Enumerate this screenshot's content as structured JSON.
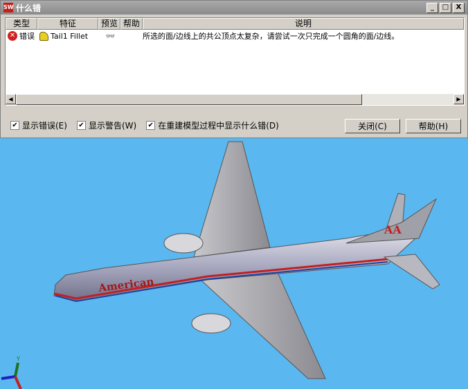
{
  "window": {
    "title": "什么错",
    "logo": "SW",
    "minimize": "_",
    "maximize": "□",
    "close": "X"
  },
  "columns": [
    "类型",
    "特征",
    "预览",
    "帮助",
    "说明"
  ],
  "rows": [
    {
      "type": "错误",
      "feature": "Tail1 Fillet",
      "description": "所选的面/边线上的共公顶点太复杂，请尝试一次只完成一个圆角的面/边线。"
    }
  ],
  "options": [
    {
      "label": "显示错误(E)",
      "checked": true
    },
    {
      "label": "显示警告(W)",
      "checked": true
    },
    {
      "label": "在重建模型过程中显示什么错(D)",
      "checked": true
    }
  ],
  "buttons": {
    "close": "关闭(C)",
    "help": "帮助(H)"
  },
  "viewport": {
    "livery_text": "American",
    "tail_logo": "AA",
    "axis_label": "Y"
  }
}
